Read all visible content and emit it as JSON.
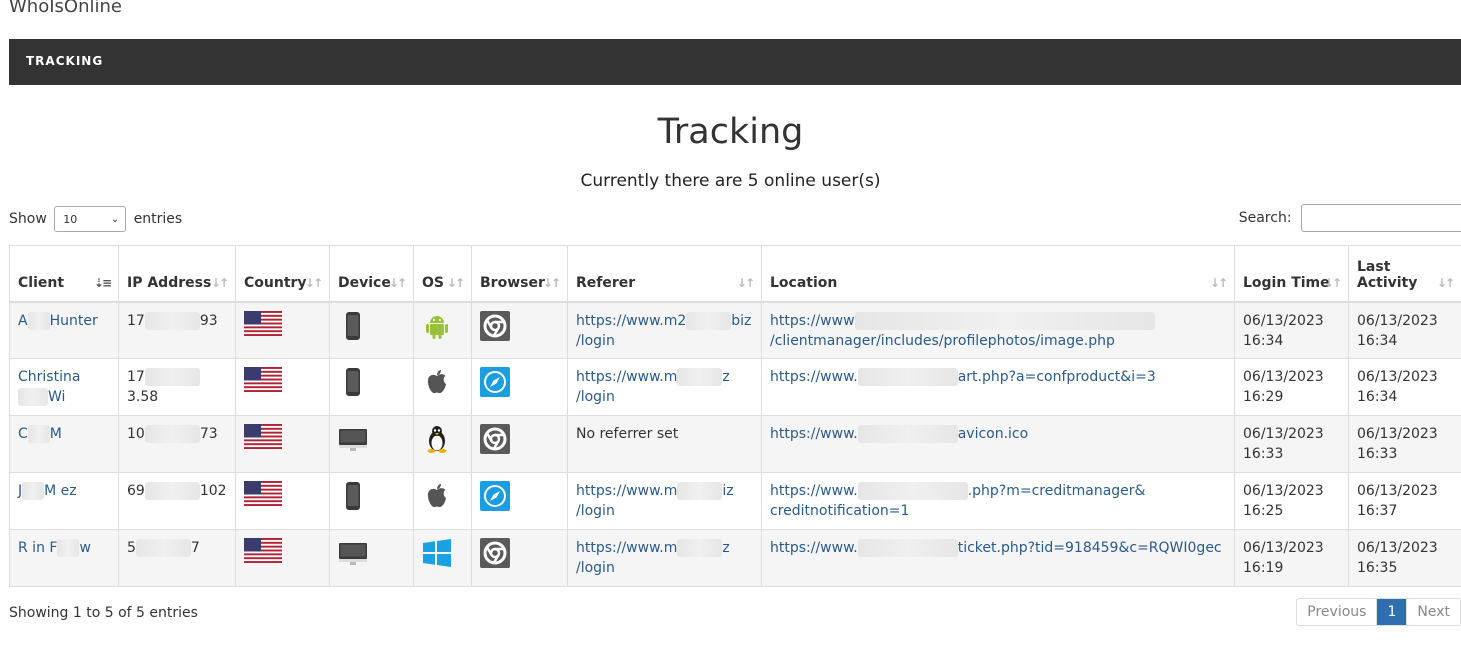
{
  "app": {
    "title": "WhoIsOnline"
  },
  "nav": {
    "tracking": "TRACKING"
  },
  "page": {
    "title": "Tracking",
    "subtitle": "Currently there are 5 online user(s)"
  },
  "length": {
    "show": "Show",
    "value": "10",
    "entries": "entries"
  },
  "search": {
    "label": "Search:",
    "placeholder": ""
  },
  "table": {
    "headers": [
      "Client",
      "IP Address",
      "Country",
      "Device",
      "OS",
      "Browser",
      "Referer",
      "Location",
      "Login Time",
      "Last Activity"
    ],
    "rows": [
      {
        "client_a": "A",
        "client_b": "Hunter",
        "ip_a": "17",
        "ip_b": "93",
        "country": "us-flag",
        "device": "tablet-icon",
        "os": "android-icon",
        "browser": "chrome-icon",
        "ref_a": "https://www.m2",
        "ref_b": "biz",
        "ref_c": "/login",
        "loc_a": "https://www",
        "loc_b": "",
        "loc_c": "/clientmanager/includes/profilephotos/image.php",
        "login_date": "06/13/2023",
        "login_time": "16:34",
        "last_date": "06/13/2023",
        "last_time": "16:34"
      },
      {
        "client_a": "Christina",
        "client_b": "Wi",
        "ip_a": "17",
        "ip_b": "3.58",
        "country": "us-flag",
        "device": "tablet-icon",
        "os": "apple-icon",
        "browser": "safari-icon",
        "ref_a": "https://www.m",
        "ref_b": "z",
        "ref_c": "/login",
        "loc_a": "https://www.",
        "loc_b": "art.php?a=confproduct&i=3",
        "loc_c": "",
        "login_date": "06/13/2023",
        "login_time": "16:29",
        "last_date": "06/13/2023",
        "last_time": "16:34"
      },
      {
        "client_a": "C",
        "client_b": "M",
        "ip_a": "10",
        "ip_b": "73",
        "country": "us-flag",
        "device": "desktop-icon",
        "os": "linux-icon",
        "browser": "chrome-icon",
        "ref_a": "No referrer set",
        "ref_b": "",
        "ref_c": "",
        "loc_a": "https://www.",
        "loc_b": "avicon.ico",
        "loc_c": "",
        "login_date": "06/13/2023",
        "login_time": "16:33",
        "last_date": "06/13/2023",
        "last_time": "16:33"
      },
      {
        "client_a": "J",
        "client_b": "M ez",
        "ip_a": "69",
        "ip_b": "102",
        "country": "us-flag",
        "device": "tablet-icon",
        "os": "apple-icon",
        "browser": "safari-icon",
        "ref_a": "https://www.m",
        "ref_b": "iz",
        "ref_c": "/login",
        "loc_a": "https://www.",
        "loc_b": ".php?m=creditmanager&",
        "loc_c": "creditnotification=1",
        "login_date": "06/13/2023",
        "login_time": "16:25",
        "last_date": "06/13/2023",
        "last_time": "16:37"
      },
      {
        "client_a": "R in F",
        "client_b": "w",
        "ip_a": "5",
        "ip_b": "7",
        "country": "us-flag",
        "device": "desktop-icon",
        "os": "windows-icon",
        "browser": "chrome-icon",
        "ref_a": "https://www.m",
        "ref_b": "z",
        "ref_c": "/login",
        "loc_a": "https://www.",
        "loc_b": "ticket.php?tid=918459&c=RQWI0gec",
        "loc_c": "",
        "login_date": "06/13/2023",
        "login_time": "16:19",
        "last_date": "06/13/2023",
        "last_time": "16:35"
      }
    ]
  },
  "footer": {
    "info": "Showing 1 to 5 of 5 entries",
    "previous": "Previous",
    "page": "1",
    "next": "Next"
  },
  "colors": {
    "navbar": "#333333",
    "link": "#2a5a8a",
    "pager_active": "#2f6fb0",
    "android": "#9bc13c",
    "safari": "#1a9ee0",
    "windows": "#1ba1e2"
  }
}
